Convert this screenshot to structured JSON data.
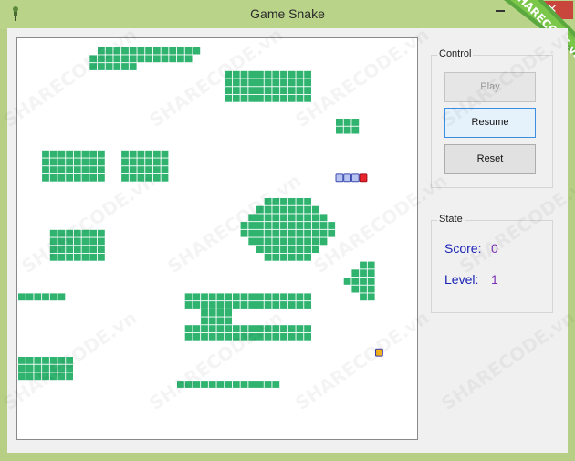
{
  "window": {
    "title": "Game Snake",
    "close_glyph": "✕"
  },
  "controls": {
    "group_title": "Control",
    "play_label": "Play",
    "resume_label": "Resume",
    "reset_label": "Reset"
  },
  "state": {
    "group_title": "State",
    "score_label": "Score:",
    "score_value": "0",
    "level_label": "Level:",
    "level_value": "1"
  },
  "watermark": "SHARECODE.vn",
  "colors": {
    "wall": "#2fb36f",
    "snake_head": "#e8242c",
    "snake_body": "#b9c3f0",
    "food": "#f1b21d"
  },
  "game": {
    "snake": [
      [
        43,
        17
      ],
      [
        42,
        17
      ],
      [
        41,
        17
      ],
      [
        40,
        17
      ]
    ],
    "food": [
      45,
      39
    ],
    "walls": [
      [
        10,
        1,
        22,
        1
      ],
      [
        9,
        2,
        14,
        3
      ],
      [
        15,
        2,
        21,
        2
      ],
      [
        26,
        4,
        36,
        7
      ],
      [
        40,
        10,
        42,
        11
      ],
      [
        3,
        14,
        10,
        17
      ],
      [
        13,
        14,
        18,
        17
      ],
      [
        31,
        20,
        36,
        20
      ],
      [
        30,
        21,
        37,
        21
      ],
      [
        29,
        22,
        38,
        22
      ],
      [
        28,
        23,
        39,
        23
      ],
      [
        28,
        24,
        39,
        24
      ],
      [
        29,
        25,
        38,
        25
      ],
      [
        30,
        26,
        37,
        26
      ],
      [
        31,
        27,
        36,
        27
      ],
      [
        4,
        24,
        10,
        27
      ],
      [
        43,
        28,
        44,
        28
      ],
      [
        42,
        29,
        44,
        29
      ],
      [
        41,
        30,
        44,
        30
      ],
      [
        42,
        31,
        44,
        31
      ],
      [
        43,
        32,
        44,
        32
      ],
      [
        0,
        32,
        5,
        32
      ],
      [
        21,
        32,
        36,
        33
      ],
      [
        23,
        34,
        26,
        35
      ],
      [
        21,
        36,
        36,
        37
      ],
      [
        0,
        40,
        6,
        42
      ],
      [
        20,
        43,
        32,
        43
      ]
    ]
  }
}
